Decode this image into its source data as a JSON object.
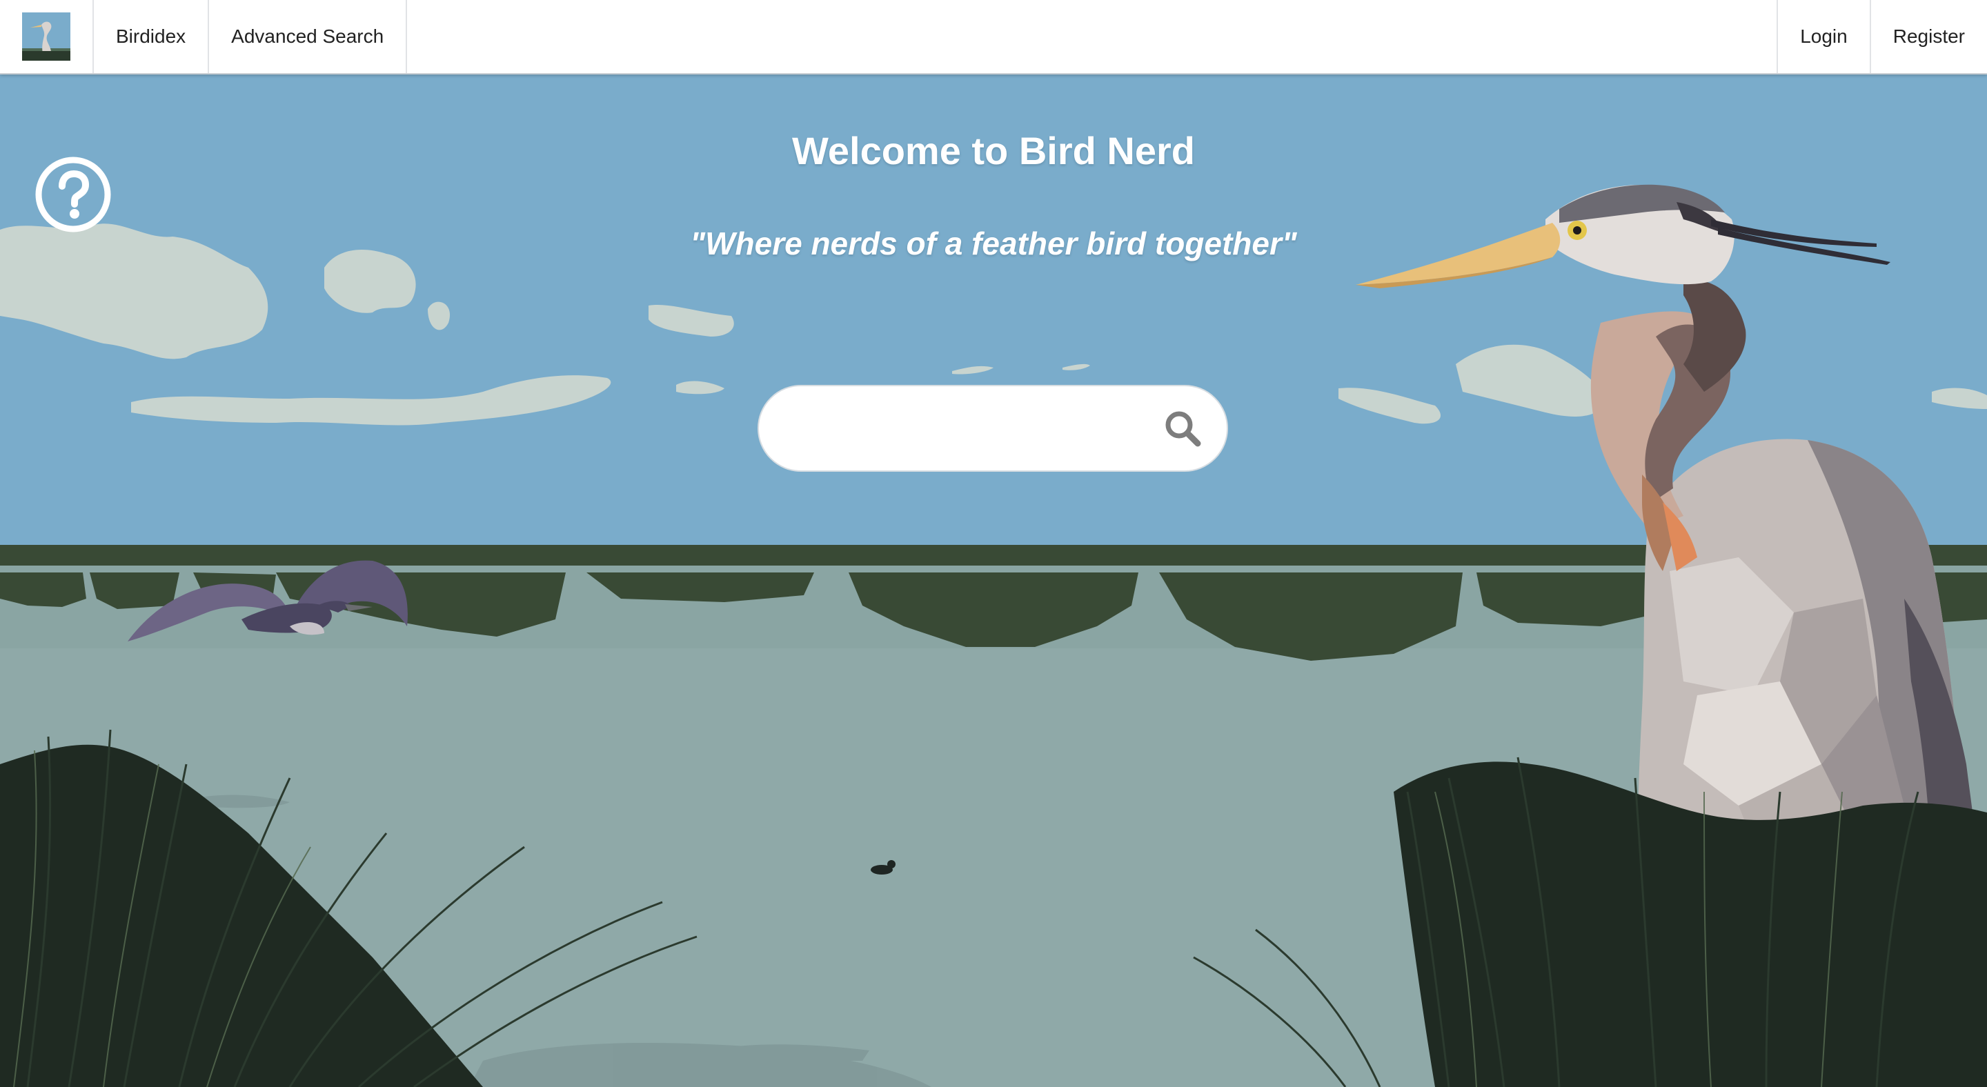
{
  "nav": {
    "logo_icon": "heron-logo-icon",
    "left_links": [
      "Birdidex",
      "Advanced Search"
    ],
    "right_links": [
      "Login",
      "Register"
    ]
  },
  "hero": {
    "title": "Welcome to Bird Nerd",
    "tagline": "\"Where nerds of a feather bird together\""
  },
  "search": {
    "placeholder": "",
    "value": "",
    "icon": "search-icon"
  },
  "help": {
    "icon": "question-circle-icon"
  },
  "colors": {
    "sky": "#7aaccb",
    "water": "#8fa9a8",
    "marsh": "#394a35",
    "grass": "#1e2a22",
    "heron": "#c8c0bc",
    "beak": "#e8c07a"
  }
}
